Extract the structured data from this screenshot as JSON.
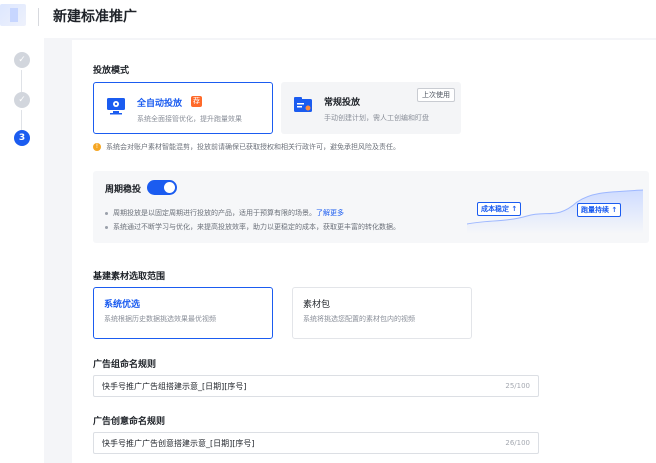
{
  "header": {
    "title": "新建标准推广"
  },
  "stepper": {
    "active_step": "3"
  },
  "delivery_mode": {
    "section_title": "投放模式",
    "options": [
      {
        "title": "全自动投放",
        "badge": "荐",
        "desc": "系统全面接管优化，提升跑量效果",
        "selected": true
      },
      {
        "title": "常规投放",
        "desc": "手动创建计划，需人工创编和盯盘",
        "tag": "上次使用",
        "selected": false
      }
    ],
    "notice": "系统会对账户素材智能混剪，投放前请确保已获取授权和相关行政许可，避免承担风险及责任。"
  },
  "cycle_stable": {
    "label": "周期稳投",
    "enabled": true,
    "bullets": [
      {
        "text": "周期投放是以固定周期进行投放的产品，适用于预算有限的场景。",
        "link": "了解更多"
      },
      {
        "text": "系统通过不断学习与优化，来提高投放效率，助力以更稳定的成本，获取更丰富的转化数据。"
      }
    ],
    "viz_tags": [
      "成本稳定 ↑",
      "跑量持续 ↑"
    ]
  },
  "material_range": {
    "section_title": "基建素材选取范围",
    "options": [
      {
        "title": "系统优选",
        "desc": "系统根据历史数据挑选效果最优视频",
        "selected": true
      },
      {
        "title": "素材包",
        "desc": "系统将挑选您配置的素材包内的视频",
        "selected": false
      }
    ]
  },
  "ad_group_naming": {
    "label": "广告组命名规则",
    "value": "快手号推广广告组搭建示意_[日期][序号]",
    "count": "25/100"
  },
  "ad_creative_naming": {
    "label": "广告创意命名规则",
    "value": "快手号推广广告创意搭建示意_[日期][序号]",
    "count": "26/100"
  },
  "colors": {
    "accent": "#1b5cf0",
    "badge": "#ff6a2a",
    "warning": "#f5a623"
  },
  "icons": [
    "check-icon",
    "monitor-auto-icon",
    "manual-folder-icon",
    "info-icon"
  ]
}
